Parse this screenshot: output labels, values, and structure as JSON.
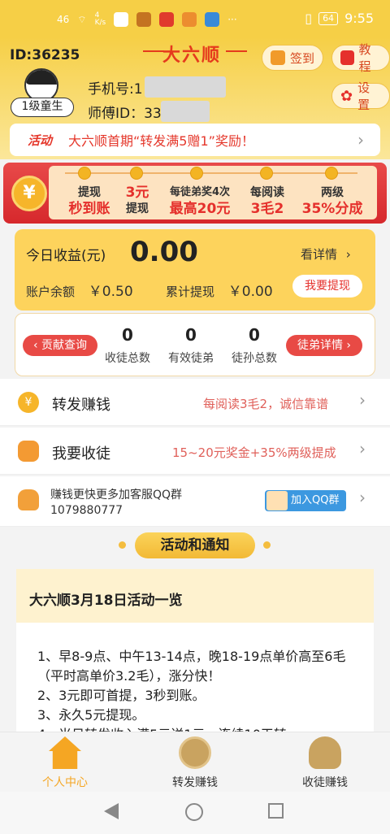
{
  "status_bar": {
    "signal": "46",
    "net_speed": "4\nK/s",
    "battery": "64",
    "time": "9:55",
    "more": "···"
  },
  "header": {
    "id_label": "ID:36235",
    "logo": "大六顺",
    "sign_in_label": "签到",
    "tutorial_label": "教程",
    "settings_label": "设置",
    "level_badge": "1级童生",
    "phone_label": "手机号:",
    "phone_value": "1",
    "master_label": "师傅ID：",
    "master_value": "33000"
  },
  "notice": {
    "tag": "活动",
    "text": "大六顺首期“转发满5赠1”奖励！"
  },
  "promo": {
    "items": [
      {
        "a": "提现",
        "b": "秒到账"
      },
      {
        "a": "3元",
        "b": "提现"
      },
      {
        "a": "每徒弟奖4次",
        "b": "最高20元"
      },
      {
        "a": "每阅读",
        "b": "3毛2"
      },
      {
        "a": "两级",
        "b": "35%分成"
      }
    ]
  },
  "earnings": {
    "today_label": "今日收益(元)",
    "today_value": "0.00",
    "detail_label": "看详情",
    "balance_label": "账户余额",
    "balance_value": "￥0.50",
    "total_label": "累计提现",
    "total_value": "￥0.00",
    "withdraw_label": "我要提现"
  },
  "stats": {
    "contribution_label": "贡献查询",
    "detail_label": "徒弟详情",
    "items": [
      {
        "value": "0",
        "label": "收徒总数"
      },
      {
        "value": "0",
        "label": "有效徒弟"
      },
      {
        "value": "0",
        "label": "徒孙总数"
      }
    ]
  },
  "rows": {
    "share": {
      "title": "转发赚钱",
      "sub": "每阅读3毛2，诚信靠谱"
    },
    "recruit": {
      "title": "我要收徒",
      "sub": "15~20元奖金+35%两级提成"
    },
    "qq": {
      "line1": "赚钱更快更多加客服QQ群",
      "line2": "1079880777",
      "button": "加入QQ群"
    }
  },
  "section_title": "活动和通知",
  "activity": {
    "title": "大六顺3月18日活动一览",
    "lines": [
      "1、早8-9点、中午13-14点，晚18-19点单价高至6毛（平时高单价3.2毛），涨分快！",
      "2、3元即可首提，3秒到账。",
      "3、永久5元提现。",
      "4、当日转发收入满5元送1元，连续10天转"
    ]
  },
  "nav": {
    "items": [
      {
        "label": "个人中心"
      },
      {
        "label": "转发赚钱"
      },
      {
        "label": "收徒赚钱"
      }
    ]
  },
  "colors": {
    "accent": "#f6cf46",
    "red": "#e5302c",
    "nav_active": "#f5a623"
  }
}
